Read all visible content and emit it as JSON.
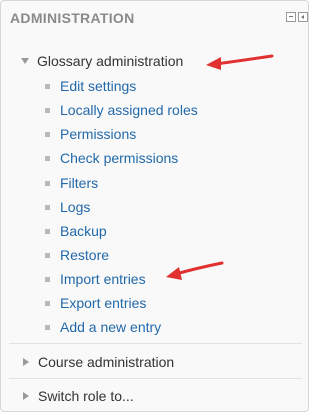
{
  "block": {
    "title": "ADMINISTRATION",
    "controls": {
      "hide_icon": "minus-box-icon",
      "dock_icon": "dock-left-icon"
    }
  },
  "glossary": {
    "label": "Glossary administration",
    "expanded": true,
    "items": [
      {
        "label": "Edit settings"
      },
      {
        "label": "Locally assigned roles"
      },
      {
        "label": "Permissions"
      },
      {
        "label": "Check permissions"
      },
      {
        "label": "Filters"
      },
      {
        "label": "Logs"
      },
      {
        "label": "Backup"
      },
      {
        "label": "Restore"
      },
      {
        "label": "Import entries"
      },
      {
        "label": "Export entries"
      },
      {
        "label": "Add a new entry"
      }
    ]
  },
  "course_admin": {
    "label": "Course administration",
    "expanded": false
  },
  "switch_role": {
    "label": "Switch role to...",
    "expanded": false
  },
  "colors": {
    "link": "#2269aa",
    "heading": "#8a8a8a",
    "annotation_arrow": "#e03030"
  }
}
